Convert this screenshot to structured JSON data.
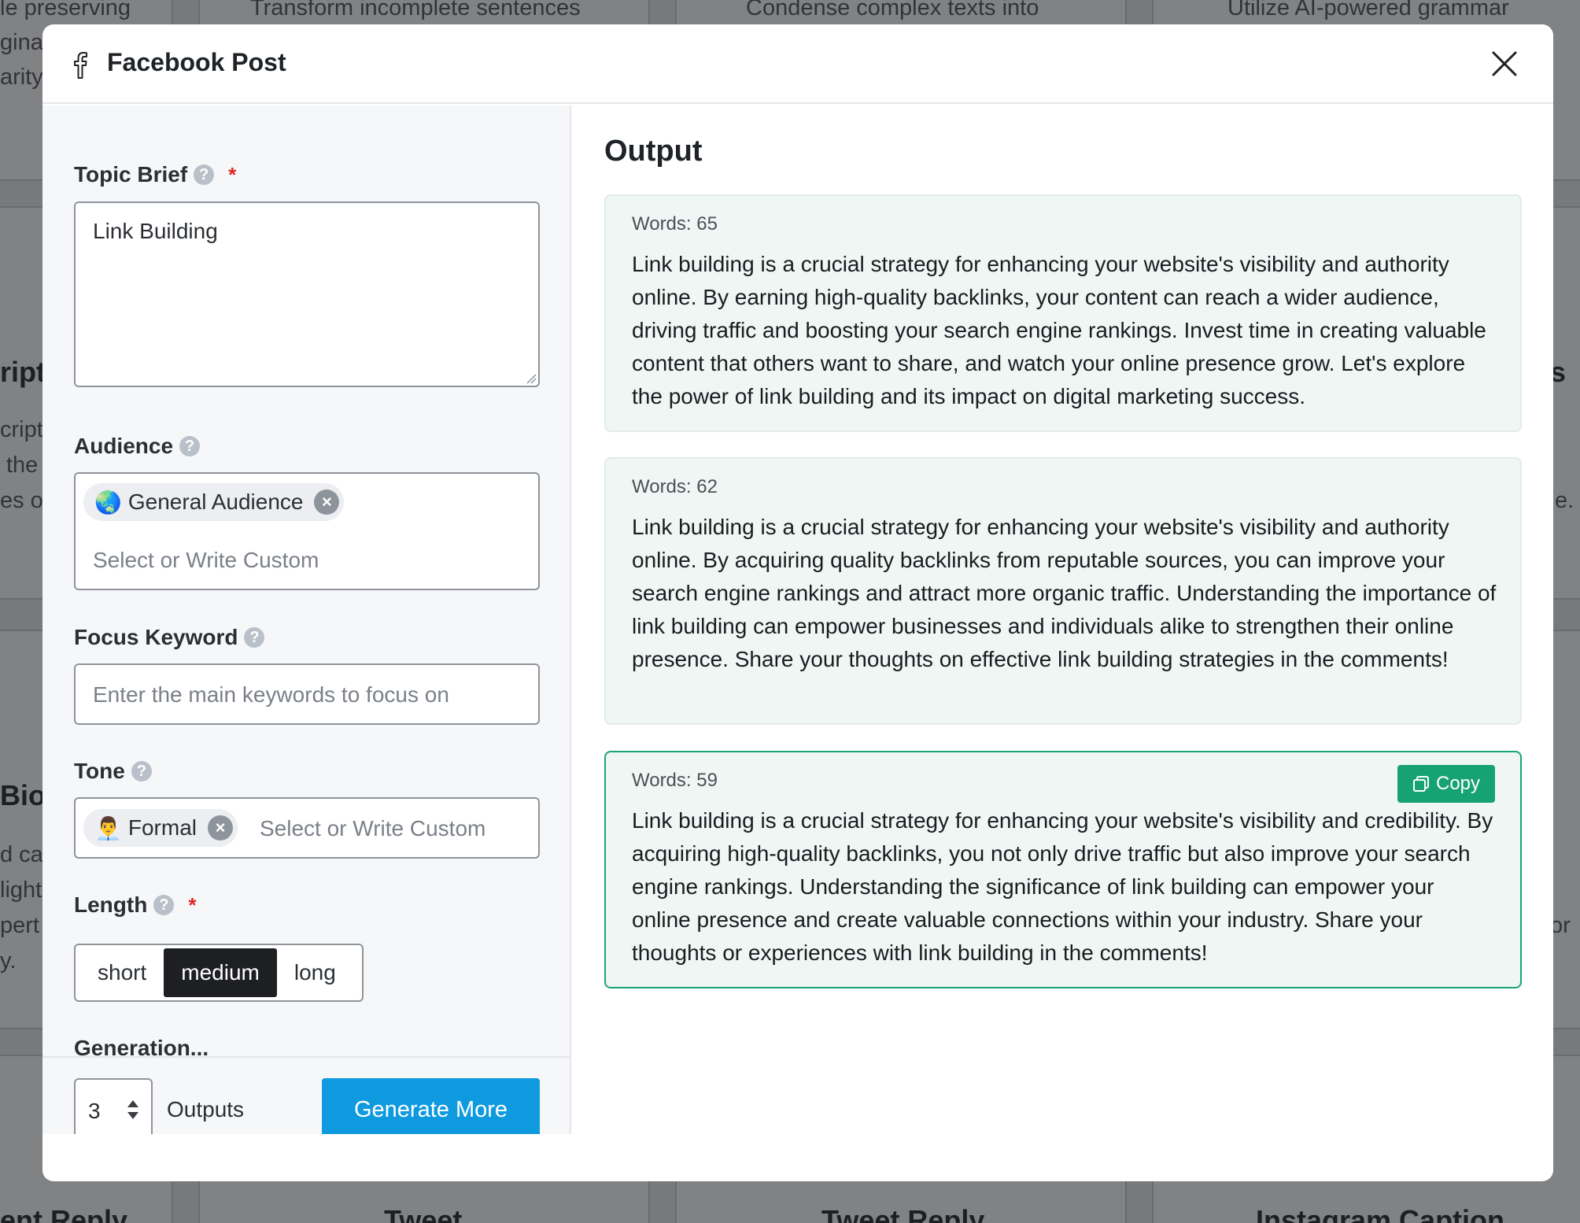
{
  "background": {
    "snippets": [
      "le preserving",
      "Transform incomplete sentences",
      "Condense complex texts into",
      "Utilize AI-powered grammar",
      "gina",
      "arity.",
      "ript",
      "cripti",
      "the",
      "es o",
      "s",
      "e.",
      "Bio",
      "d ca",
      "light",
      "pert",
      "y.",
      "or",
      "ent Reply",
      "Tweet",
      "Tweet Reply",
      "Instagram Caption"
    ]
  },
  "modal": {
    "title": "Facebook Post",
    "icon": "facebook-icon",
    "close_icon": "close-icon"
  },
  "form": {
    "topic": {
      "label": "Topic Brief",
      "required_mark": "*",
      "value": "Link Building"
    },
    "audience": {
      "label": "Audience",
      "chip_emoji": "🌏",
      "chip_label": "General Audience",
      "placeholder": "Select or Write Custom"
    },
    "keyword": {
      "label": "Focus Keyword",
      "placeholder": "Enter the main keywords to focus on"
    },
    "tone": {
      "label": "Tone",
      "chip_emoji": "👨‍💼",
      "chip_label": "Formal",
      "placeholder": "Select or Write Custom"
    },
    "length": {
      "label": "Length",
      "required_mark": "*",
      "options": [
        "short",
        "medium",
        "long"
      ],
      "selected": "medium"
    },
    "cutoff_label": "Generation..."
  },
  "footer": {
    "count": "3",
    "outputs_label": "Outputs",
    "generate_label": "Generate More"
  },
  "output": {
    "title": "Output",
    "copy_label": "Copy",
    "results": [
      {
        "words": "Words: 65",
        "text": "Link building is a crucial strategy for enhancing your website's visibility and authority online. By earning high-quality backlinks, your content can reach a wider audience, driving traffic and boosting your search engine rankings. Invest time in creating valuable content that others want to share, and watch your online presence grow. Let's explore the power of link building and its impact on digital marketing success."
      },
      {
        "words": "Words: 62",
        "text": "Link building is a crucial strategy for enhancing your website's visibility and authority online. By acquiring quality backlinks from reputable sources, you can improve your search engine rankings and attract more organic traffic. Understanding the importance of link building can empower businesses and individuals alike to strengthen their online presence. Share your thoughts on effective link building strategies in the comments!"
      },
      {
        "words": "Words: 59",
        "text": "Link building is a crucial strategy for enhancing your website's visibility and credibility. By acquiring high-quality backlinks, you not only drive traffic but also improve your search engine rankings. Understanding the significance of link building can empower your online presence and create valuable connections within your industry. Share your thoughts or experiences with link building in the comments!"
      }
    ]
  }
}
